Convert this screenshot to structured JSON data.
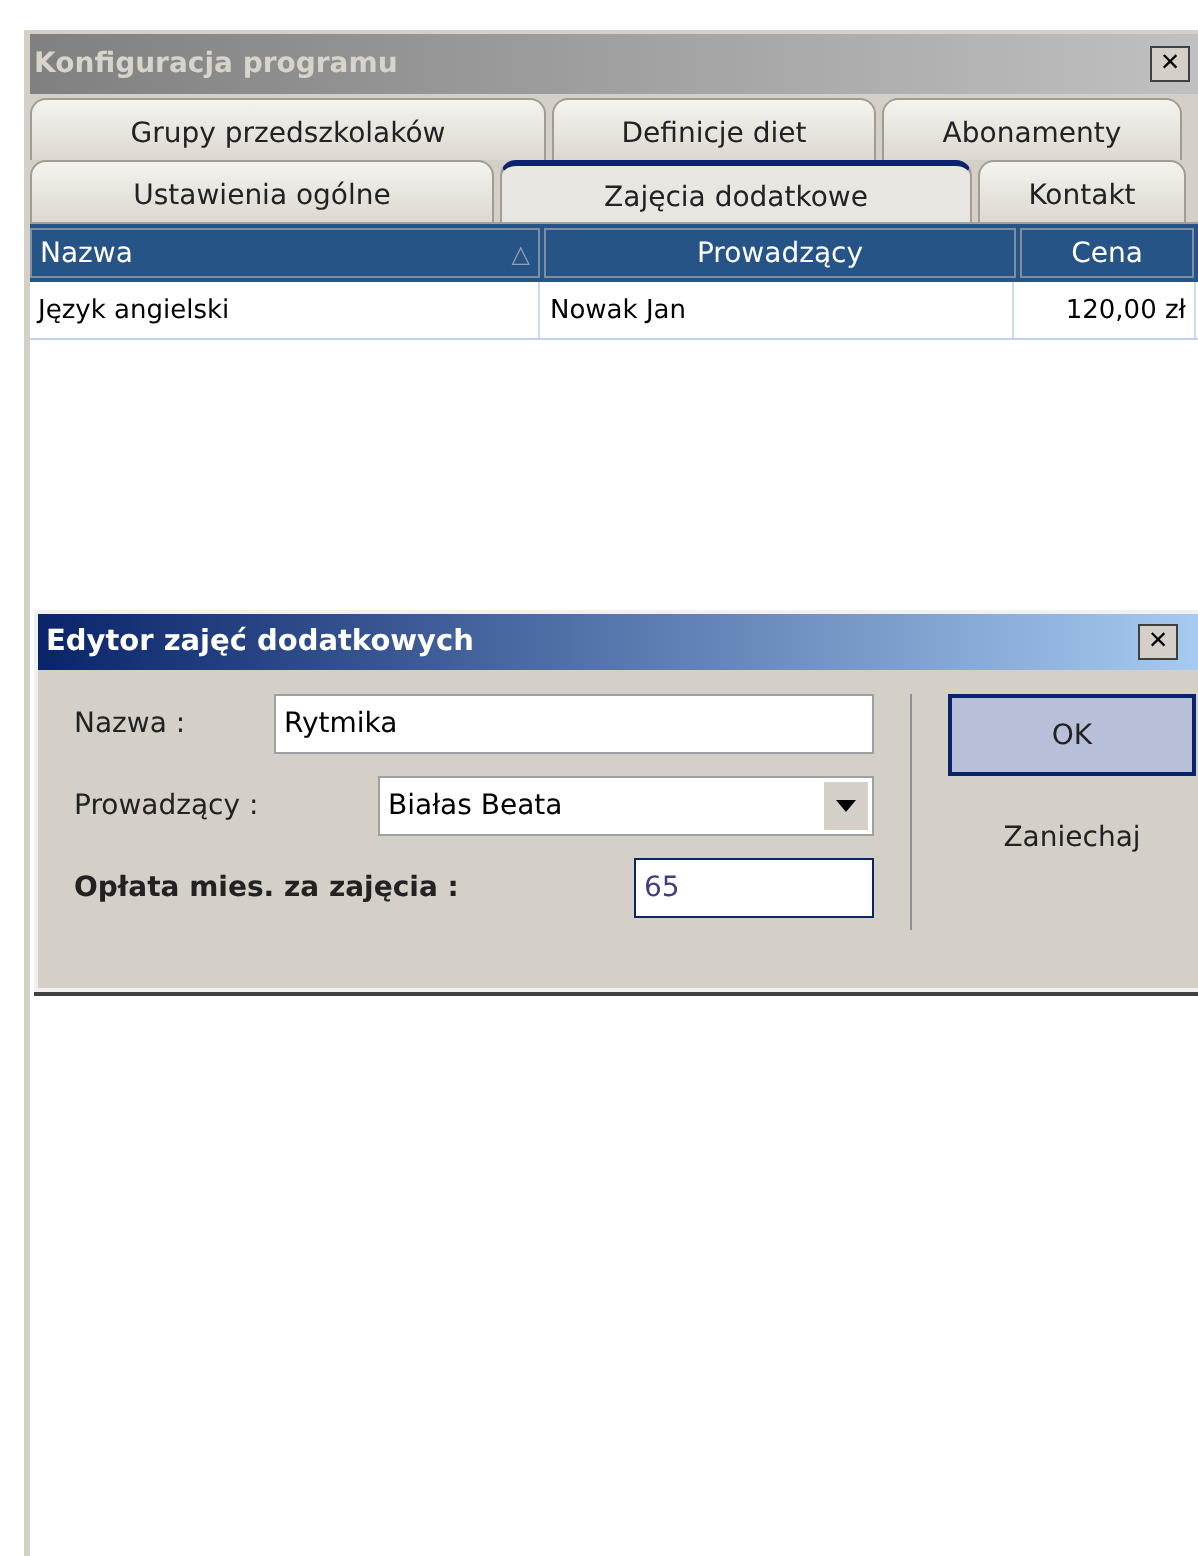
{
  "window": {
    "title": "Konfiguracja programu",
    "close": "×"
  },
  "tab_rows": [
    {
      "tabs": [
        {
          "label": "Grupy przedszkolaków",
          "selected": false
        },
        {
          "label": "Definicje diet",
          "selected": false
        },
        {
          "label": "Abonamenty",
          "selected": false
        }
      ]
    },
    {
      "tabs": [
        {
          "label": "Ustawienia ogólne",
          "selected": false
        },
        {
          "label": "Zajęcia dodatkowe",
          "selected": true
        },
        {
          "label": "Kontakt",
          "selected": false
        }
      ]
    }
  ],
  "table": {
    "columns": [
      {
        "label": "Nazwa",
        "sort": "△"
      },
      {
        "label": "Prowadzący"
      },
      {
        "label": "Cena"
      }
    ],
    "rows": [
      [
        "Język angielski",
        "Nowak Jan",
        "120,00 zł"
      ]
    ]
  },
  "dialog": {
    "title": "Edytor zajęć dodatkowych",
    "close": "×",
    "fields": [
      {
        "kind": "text",
        "label": "Nazwa :",
        "value": "Rytmika"
      },
      {
        "kind": "select",
        "label": "Prowadzący :",
        "value": "Białas Beata"
      },
      {
        "kind": "text",
        "label": "Opłata mies. za zajęcia :",
        "value": "65",
        "bold": true,
        "focused": true
      }
    ],
    "buttons": [
      {
        "label": "OK",
        "default": true
      },
      {
        "label": "Zaniechaj",
        "default": false
      }
    ]
  }
}
